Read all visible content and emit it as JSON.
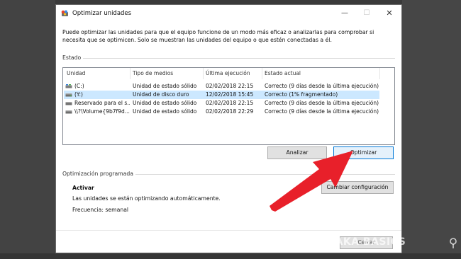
{
  "window": {
    "title": "Optimizar unidades",
    "controls": {
      "minimize": "—",
      "maximize": "☐",
      "close": "✕"
    }
  },
  "description": "Puede optimizar las unidades para que el equipo funcione de un modo más eficaz o analizarlas para comprobar si necesita que se optimicen. Solo se muestran las unidades del equipo o que estén conectadas a él.",
  "status_section": {
    "label": "Estado",
    "columns": [
      "Unidad",
      "Tipo de medios",
      "Última ejecución",
      "Estado actual"
    ],
    "rows": [
      {
        "unit": "(C:)",
        "media": "Unidad de estado sólido",
        "last_run": "02/02/2018 22:15",
        "status": "Correcto (9 días desde la última ejecución)",
        "selected": false,
        "icon": "ssd-drive-icon"
      },
      {
        "unit": "(Y:)",
        "media": "Unidad de disco duro",
        "last_run": "12/02/2018 15:45",
        "status": "Correcto (1% fragmentado)",
        "selected": true,
        "icon": "hdd-drive-icon"
      },
      {
        "unit": "Reservado para el s...",
        "media": "Unidad de estado sólido",
        "last_run": "02/02/2018 22:15",
        "status": "Correcto (9 días desde la última ejecución)",
        "selected": false,
        "icon": "ssd-drive-icon"
      },
      {
        "unit": "\\\\?\\Volume{9b7f9d...",
        "media": "Unidad de estado sólido",
        "last_run": "02/02/2018 22:29",
        "status": "Correcto (9 días desde la última ejecución)",
        "selected": false,
        "icon": "ssd-drive-icon"
      }
    ]
  },
  "actions": {
    "analyze": "Analizar",
    "optimize": "Optimizar"
  },
  "scheduled": {
    "label": "Optimización programada",
    "state": "Activar",
    "detail": "Las unidades se están optimizando automáticamente.",
    "frequency": "Frecuencia: semanal",
    "change_button": "Cambiar configuración"
  },
  "close_button": "Cerrar",
  "watermark": "XATAKA BASICS",
  "colors": {
    "selection": "#cce8ff",
    "accent": "#0078d7",
    "arrow": "#e8202a"
  }
}
